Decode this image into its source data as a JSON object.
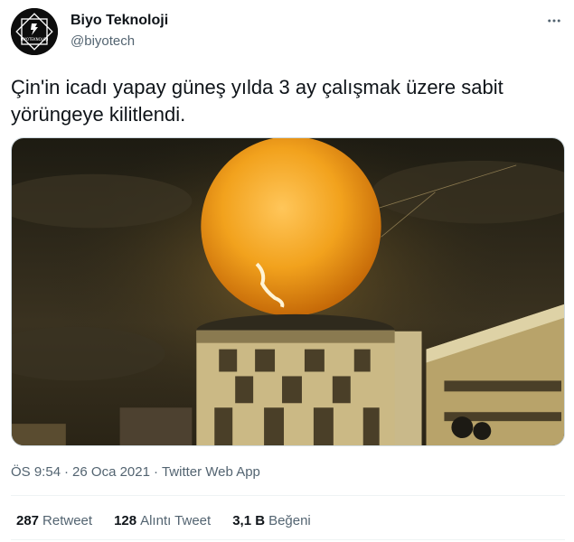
{
  "author": {
    "display_name": "Biyo Teknoloji",
    "handle": "@biyotech",
    "avatar_text": "BIYOTEKNOLOJI",
    "avatar_icon": "biyo-logo-icon"
  },
  "more_icon": "more-dots-icon",
  "tweet": {
    "text": "Çin'in icadı yapay güneş yılda 3 ay çalışmak üzere sabit yörüngeye kilitlendi."
  },
  "media": {
    "icon": "artificial-sun-photo",
    "colors": {
      "sun": "#f2a21d",
      "sky": "#2b2718",
      "building": "#b8a36a"
    }
  },
  "meta": {
    "time": "ÖS 9:54",
    "separator": "·",
    "date": "26 Oca 2021",
    "source": "Twitter Web App"
  },
  "stats": {
    "retweets": {
      "count": "287",
      "label": "Retweet"
    },
    "quotes": {
      "count": "128",
      "label": "Alıntı Tweet"
    },
    "likes": {
      "count": "3,1 B",
      "label": "Beğeni"
    }
  }
}
